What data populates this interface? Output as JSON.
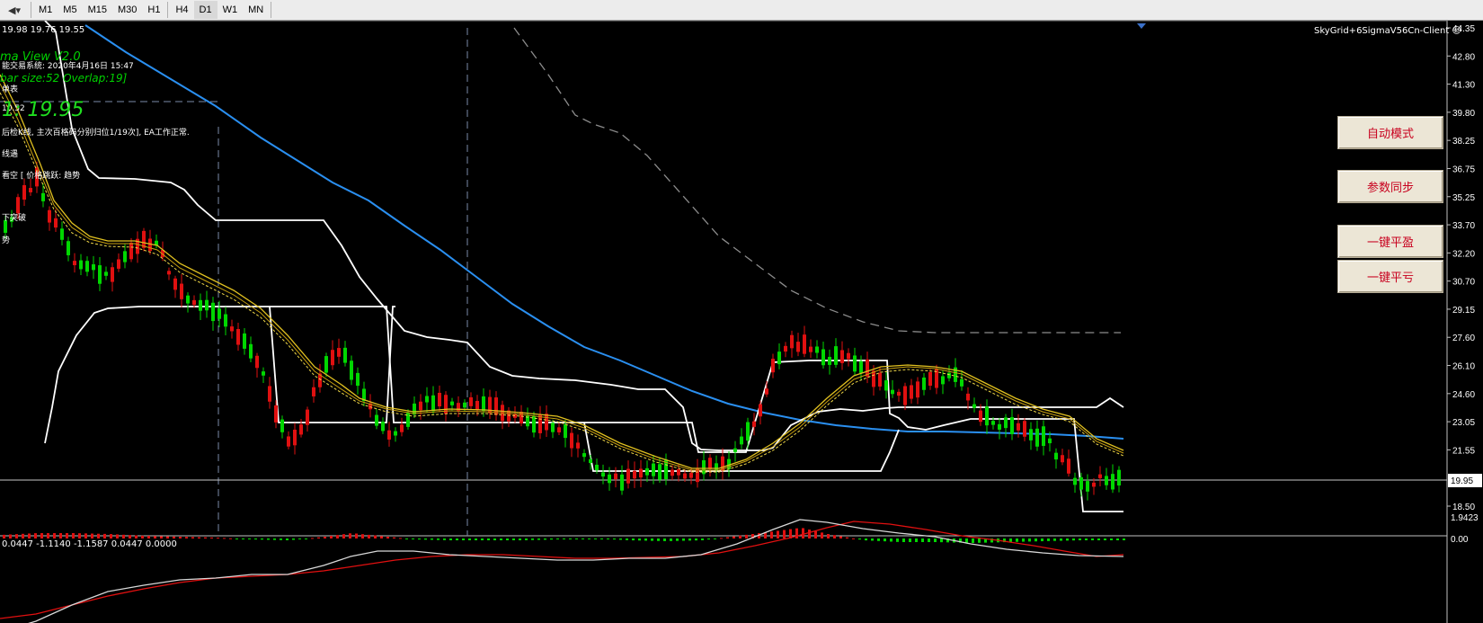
{
  "toolbar": {
    "timeframes": [
      "M1",
      "M5",
      "M15",
      "M30",
      "H1",
      "H4",
      "D1",
      "W1",
      "MN"
    ],
    "active_timeframe": "D1"
  },
  "chart": {
    "ohlc_header": "19.98 19.76 19.55",
    "client_label": "SkyGrid+6SigmaV56Cn-Client",
    "current_price": "19.95",
    "price_scale": [
      "44.35",
      "42.80",
      "41.30",
      "39.80",
      "38.25",
      "36.75",
      "35.25",
      "33.70",
      "32.20",
      "30.70",
      "29.15",
      "27.60",
      "26.10",
      "24.60",
      "23.05",
      "21.55",
      "19.95",
      "18.50"
    ],
    "overlay": {
      "line1": "ma View V2.0",
      "line2": "能交易系统: 2020年4月16日 15:47",
      "line3": "bar size:52 Overlap:19]",
      "line4": "单表",
      "line5": "10.52",
      "big_price": "1: 19.95",
      "line6": "后检K线, 主次百格码分别归位1/19次], EA工作正常.",
      "line7": "线遇",
      "line8": "看空 [ 价格跳跃: 趋势",
      "line9": "下突破",
      "line10": "势"
    }
  },
  "indicator": {
    "header": "0.0447 -1.1140 -1.1587 0.0447 0.0000",
    "scale": [
      "1.9423",
      "0.00"
    ]
  },
  "buttons": {
    "auto_mode": "自动模式",
    "param_sync": "参数同步",
    "close_profit": "一键平盈",
    "close_loss": "一键平亏"
  },
  "colors": {
    "bull": "#00d800",
    "bear": "#e01010",
    "ma_blue": "#2a8ff0",
    "gold": "#e0c020",
    "white_band": "#ffffff",
    "button_text": "#c8001e"
  }
}
